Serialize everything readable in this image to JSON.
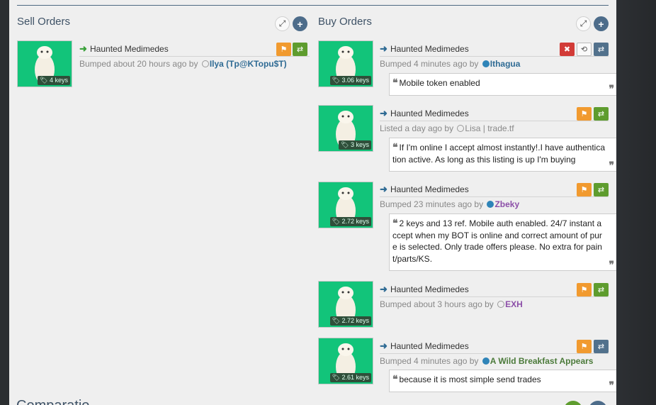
{
  "sell": {
    "title": "Sell Orders",
    "listings": [
      {
        "name": "Haunted Medimedes",
        "price": "4 keys",
        "status": "Bumped about 20 hours ago by",
        "user": "Ilya (Tp@KTopu$T)",
        "note": ""
      }
    ]
  },
  "buy": {
    "title": "Buy Orders",
    "listings": [
      {
        "name": "Haunted Medimedes",
        "price": "3.06 keys",
        "status": "Bumped 4 minutes ago by",
        "user": "Ithagua",
        "note": "Mobile token enabled"
      },
      {
        "name": "Haunted Medimedes",
        "price": "3 keys",
        "status": "Listed a day ago by",
        "user": "Lisa | trade.tf",
        "note": "If I'm online I accept almost instantly!.I have authentication active. As long as this listing is up I'm buying"
      },
      {
        "name": "Haunted Medimedes",
        "price": "2.72 keys",
        "status": "Bumped 23 minutes ago by",
        "user": "Zbeky",
        "note": "2 keys and 13 ref. Mobile auth enabled. 24/7 instant accept when my BOT is online and correct amount of pure is selected. Only trade offers please. No extra for paint/parts/KS."
      },
      {
        "name": "Haunted Medimedes",
        "price": "2.72 keys",
        "status": "Bumped about 3 hours ago by",
        "user": "EXH",
        "note": ""
      },
      {
        "name": "Haunted Medimedes",
        "price": "2.61 keys",
        "status": "Bumped 4 minutes ago by",
        "user": "A Wild Breakfast Appears",
        "note": "because it is most simple send trades"
      }
    ]
  },
  "footer": {
    "section_title": "Comparatio"
  },
  "icons": {
    "expand": "expand-icon",
    "add": "plus-icon",
    "flag": "flag-icon",
    "trade": "exchange-icon",
    "remove": "close-icon",
    "bump": "refresh-icon",
    "sell_arrow": "arrow-right-icon",
    "buy_arrow": "arrow-left-icon",
    "tag": "tag-icon",
    "quote": "quote-icon"
  },
  "colors": {
    "accent": "#4d6c8a",
    "thumb_bg": "#12c47a",
    "flag": "#f19a2f",
    "trade": "#5e9c2e",
    "remove": "#d23b37"
  }
}
